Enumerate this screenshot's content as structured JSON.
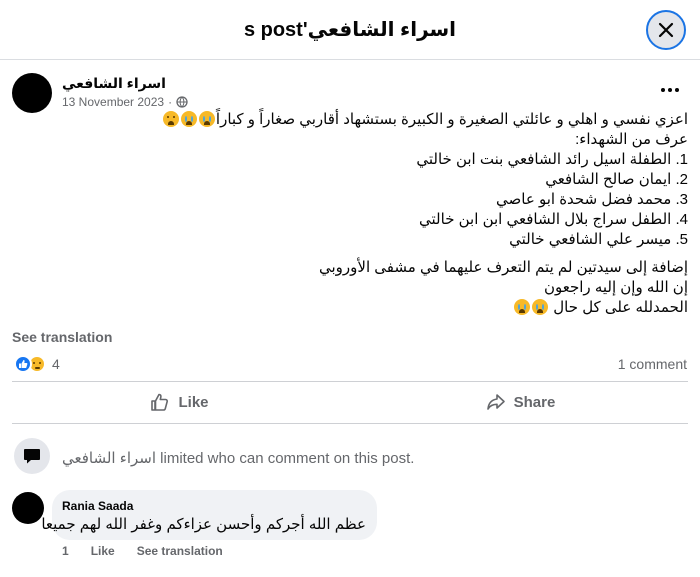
{
  "header": {
    "title": "s post'اسراء الشافعي",
    "close_label": "Close"
  },
  "post": {
    "author": "اسراء الشافعي",
    "date": "13 November 2023",
    "privacy_icon": "globe-icon",
    "lines": [
      "اعزي نفسي و اهلي و عائلتي الصغيرة و الكبيرة بستشهاد أقاربي صغاراً و كباراً",
      "عرف من الشهداء:",
      "1. الطفلة اسيل رائد الشافعي بنت ابن خالتي",
      "2. ايمان صالح الشافعي",
      "3. محمد فضل شحدة ابو عاصي",
      "4. الطفل سراج بلال الشافعي ابن ابن  خالتي",
      "5. ميسر علي الشافعي خالتي",
      "إضافة إلى سيدتين لم يتم التعرف عليهما في مشفى الأوروبي",
      "إن الله وإن إليه راجعون",
      "الحمدلله على كل حال"
    ],
    "see_translation": "See translation"
  },
  "reactions": {
    "count": "4",
    "comments": "1 comment",
    "types": [
      "like-icon",
      "sad-icon"
    ]
  },
  "actions": {
    "like": "Like",
    "share": "Share"
  },
  "notice": {
    "text": "اسراء الشافعي limited who can comment on this post."
  },
  "comment": {
    "author": "Rania Saada",
    "text": "عظم الله أجركم وأحسن عزاءكم وغفر الله لهم جميعا",
    "time": "1",
    "like": "Like",
    "see_translation": "See translation"
  },
  "colors": {
    "accent": "#1877f2",
    "muted_text": "#65676b",
    "bubble": "#f0f2f5"
  }
}
